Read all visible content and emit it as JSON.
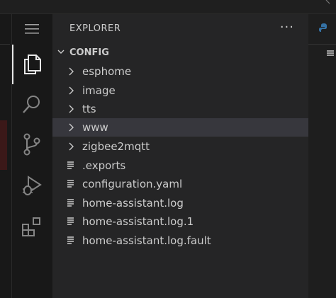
{
  "explorer": {
    "title": "EXPLORER",
    "more_label": "···",
    "root_label": "CONFIG"
  },
  "tree": {
    "folders": [
      "esphome",
      "image",
      "tts",
      "www",
      "zigbee2mqtt"
    ],
    "files": [
      ".exports",
      "configuration.yaml",
      "home-assistant.log",
      "home-assistant.log.1",
      "home-assistant.log.fault"
    ]
  },
  "colors": {
    "sidebar_bg": "#252526",
    "activity_bg": "#181818",
    "hover_row": "#37373d",
    "text": "#cccccc",
    "python_icon": "#3572A5"
  },
  "icons": {
    "activity": [
      "hamburger-menu-icon",
      "files-icon",
      "search-icon",
      "source-control-icon",
      "run-debug-icon",
      "extensions-icon"
    ],
    "tree": [
      "chevron-right-icon",
      "chevron-down-icon",
      "file-lines-icon"
    ],
    "editor": [
      "python-icon",
      "outline-lines-icon"
    ]
  }
}
